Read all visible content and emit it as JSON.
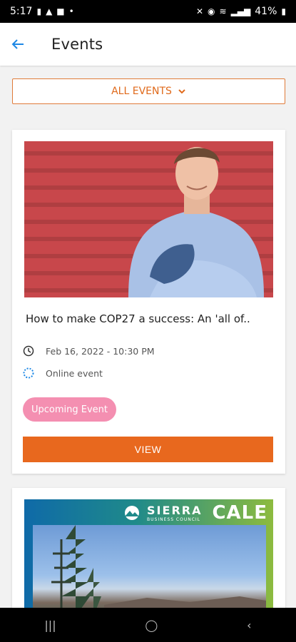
{
  "status_bar": {
    "time": "5:17",
    "battery": "41%"
  },
  "app_bar": {
    "title": "Events",
    "back_icon": "arrow-back-icon"
  },
  "filter": {
    "label": "ALL EVENTS",
    "icon": "chevron-down-icon"
  },
  "events": [
    {
      "title": "How to make COP27 a success: An 'all of..",
      "date": "Feb 16, 2022 - 10:30 PM",
      "location": "Online event",
      "badge": "Upcoming Event",
      "button": "VIEW"
    },
    {
      "logo_name": "SIERRA",
      "logo_sub": "BUSINESS COUNCIL",
      "banner_text": "CALE"
    }
  ],
  "colors": {
    "accent": "#e8681e",
    "badge": "#f48fb1",
    "back": "#1e88e5"
  }
}
